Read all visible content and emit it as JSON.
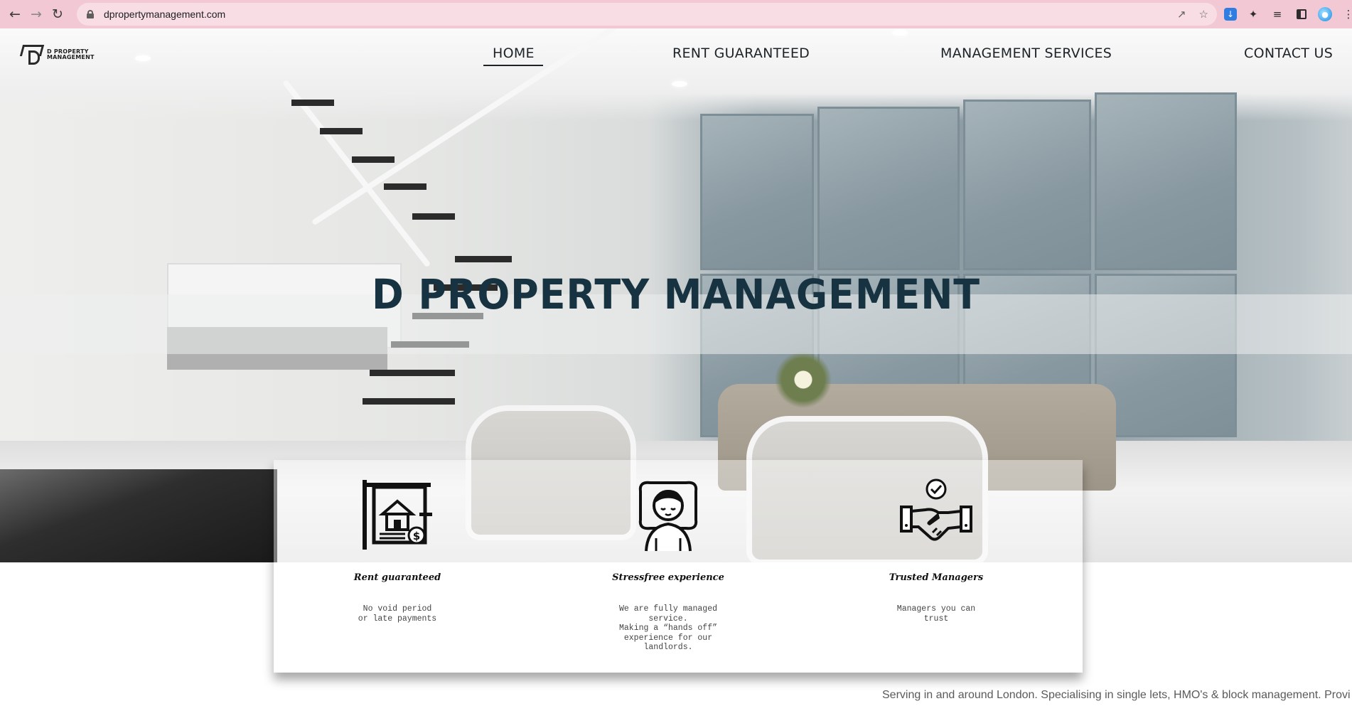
{
  "browser": {
    "url": "dpropertymanagement.com",
    "icons": {
      "back": "back-arrow-icon",
      "forward": "forward-arrow-icon",
      "reload": "reload-icon",
      "lock": "lock-icon",
      "share": "share-icon",
      "bookmark": "star-icon",
      "download": "download-icon",
      "extensions": "puzzle-icon",
      "reading_list": "reading-list-icon",
      "side_panel": "side-panel-icon",
      "profile": "profile-icon",
      "menu": "more-vertical-icon"
    }
  },
  "site": {
    "logo": {
      "line1": "D PROPERTY",
      "line2": "MANAGEMENT"
    },
    "nav": [
      {
        "label": "HOME",
        "active": true
      },
      {
        "label": "RENT GUARANTEED",
        "active": false
      },
      {
        "label": "MANAGEMENT SERVICES",
        "active": false
      },
      {
        "label": "CONTACT US",
        "active": false
      }
    ],
    "hero_title": "D PROPERTY MANAGEMENT",
    "features": [
      {
        "icon": "house-sign-dollar-icon",
        "title": "Rent guaranteed",
        "description": "No void period\nor late payments"
      },
      {
        "icon": "sleeping-person-icon",
        "title": "Stressfree experience",
        "description": "We are fully managed\nservice.\nMaking a “hands off”\nexperience for our\nlandlords."
      },
      {
        "icon": "handshake-check-icon",
        "title": "Trusted Managers",
        "description": "Managers you can\ntrust"
      }
    ],
    "serving_text": "Serving in and around London. Specialising in single lets, HMO's & block management. Provi"
  },
  "colors": {
    "browser_bar": "#f1c8d3",
    "title_text": "#173341",
    "nav_text": "#1d2327"
  }
}
